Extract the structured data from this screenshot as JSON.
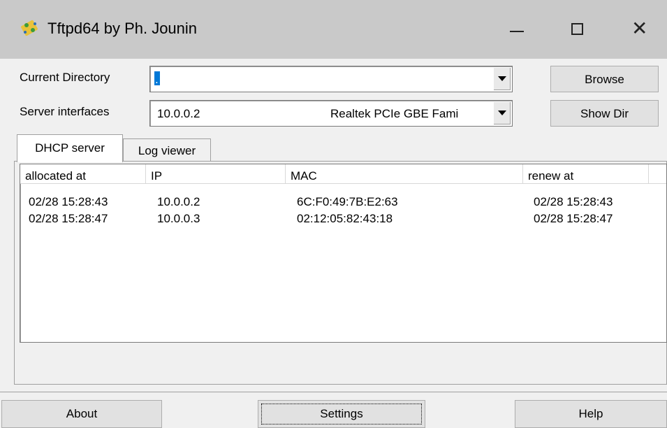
{
  "window": {
    "title": "Tftpd64 by Ph. Jounin",
    "icons": {
      "app": "tftpd-app-icon",
      "minimize": "minimize-icon",
      "maximize": "maximize-icon",
      "close": "close-icon"
    },
    "close_glyph": "✕"
  },
  "form": {
    "current_directory_label": "Current Directory",
    "current_directory_value": ".",
    "server_interfaces_label": "Server interfaces",
    "server_interface_ip": "10.0.0.2",
    "server_interface_name": "Realtek PCIe GBE Fami"
  },
  "buttons": {
    "browse": "Browse",
    "show_dir": "Show Dir",
    "about": "About",
    "settings": "Settings",
    "help": "Help"
  },
  "tabs": [
    {
      "label": "DHCP server",
      "active": true
    },
    {
      "label": "Log viewer",
      "active": false
    }
  ],
  "table": {
    "columns": [
      "allocated at",
      "IP",
      "MAC",
      "renew at"
    ],
    "rows": [
      [
        "02/28 15:28:43",
        "10.0.0.2",
        "6C:F0:49:7B:E2:63",
        "02/28 15:28:43"
      ],
      [
        "02/28 15:28:47",
        "10.0.0.3",
        "02:12:05:82:43:18",
        "02/28 15:28:47"
      ]
    ]
  },
  "colors": {
    "titlebar": "#c9c9c9",
    "selection": "#0078d7",
    "window_bg": "#f0f0f0"
  }
}
